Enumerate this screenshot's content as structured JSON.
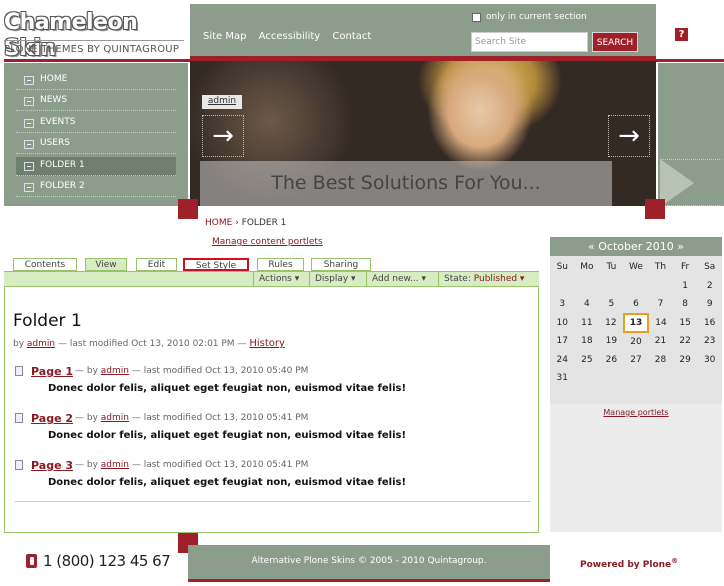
{
  "header": {
    "logo_title": "Chameleon Skin",
    "logo_subtitle": "PLONE THEMES BY QUINTAGROUP",
    "site_actions": [
      "Site Map",
      "Accessibility",
      "Contact"
    ],
    "search_checkbox_label": "only in current section",
    "search_placeholder": "Search Site",
    "search_button": "SEARCH",
    "help_icon": "?"
  },
  "nav": {
    "items": [
      {
        "label": "HOME"
      },
      {
        "label": "NEWS"
      },
      {
        "label": "EVENTS"
      },
      {
        "label": "USERS"
      },
      {
        "label": "FOLDER 1",
        "active": true
      },
      {
        "label": "FOLDER 2"
      }
    ]
  },
  "banner": {
    "user_label": "admin",
    "tagline": "The Best Solutions For You...",
    "prev_icon": "→",
    "next_icon": "→"
  },
  "breadcrumb": {
    "home": "HOME",
    "separator": "›",
    "current": "FOLDER 1"
  },
  "manage_content_portlets": "Manage content portlets",
  "tabs": [
    {
      "label": "Contents"
    },
    {
      "label": "View",
      "selected": true
    },
    {
      "label": "Edit"
    },
    {
      "label": "Set Style",
      "highlighted": true
    },
    {
      "label": "Rules"
    },
    {
      "label": "Sharing"
    }
  ],
  "actions": {
    "actions": "Actions ▾",
    "display": "Display ▾",
    "add_new": "Add new... ▾",
    "state_label": "State:",
    "state_value": "Published ▾"
  },
  "content": {
    "title": "Folder 1",
    "by": "by",
    "author": "admin",
    "modified": "— last modified Oct 13, 2010 02:01 PM —",
    "history": "History",
    "items": [
      {
        "title": "Page 1",
        "by": "— by",
        "author": "admin",
        "modified": "— last modified Oct 13, 2010 05:40 PM",
        "description": "Donec dolor felis, aliquet eget feugiat non, euismod vitae felis!"
      },
      {
        "title": "Page 2",
        "by": "— by",
        "author": "admin",
        "modified": "— last modified Oct 13, 2010 05:41 PM",
        "description": "Donec dolor felis, aliquet eget feugiat non, euismod vitae felis!"
      },
      {
        "title": "Page 3",
        "by": "— by",
        "author": "admin",
        "modified": "— last modified Oct 13, 2010 05:41 PM",
        "description": "Donec dolor felis, aliquet eget feugiat non, euismod vitae felis!"
      }
    ]
  },
  "calendar": {
    "header": "« October 2010 »",
    "day_names": [
      "Su",
      "Mo",
      "Tu",
      "We",
      "Th",
      "Fr",
      "Sa"
    ],
    "weeks": [
      [
        "",
        "",
        "",
        "",
        "",
        "1",
        "2"
      ],
      [
        "3",
        "4",
        "5",
        "6",
        "7",
        "8",
        "9"
      ],
      [
        "10",
        "11",
        "12",
        "13",
        "14",
        "15",
        "16"
      ],
      [
        "17",
        "18",
        "19",
        "20",
        "21",
        "22",
        "23"
      ],
      [
        "24",
        "25",
        "26",
        "27",
        "28",
        "29",
        "30"
      ],
      [
        "31",
        "",
        "",
        "",
        "",
        "",
        ""
      ]
    ],
    "today": "13"
  },
  "manage_portlets": "Manage portlets",
  "footer": {
    "phone": "1 (800) 123 45 67",
    "copyright": "Alternative Plone Skins © 2005 - 2010 Quintagroup.",
    "powered": "Powered by Plone",
    "powered_mark": "®"
  },
  "colors": {
    "accent": "#a0202a",
    "sage": "#8d9d8b",
    "green_border": "#9ac26a",
    "tab_fill": "#d8ecc4"
  }
}
